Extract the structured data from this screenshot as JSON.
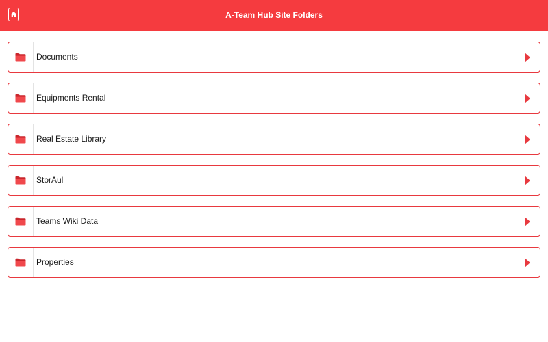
{
  "header": {
    "title": "A-Team Hub Site Folders",
    "home_icon": "home-icon",
    "background_color": "#f53b3f"
  },
  "folders": [
    {
      "label": "Documents",
      "icon": "folder-icon"
    },
    {
      "label": "Equipments Rental",
      "icon": "folder-icon"
    },
    {
      "label": "Real Estate Library",
      "icon": "folder-icon"
    },
    {
      "label": "StorAul",
      "icon": "folder-icon"
    },
    {
      "label": "Teams Wiki Data",
      "icon": "folder-icon"
    },
    {
      "label": "Properties",
      "icon": "folder-icon"
    }
  ],
  "colors": {
    "accent": "#e8393f",
    "header": "#f53b3f",
    "text": "#1a1a1a"
  }
}
